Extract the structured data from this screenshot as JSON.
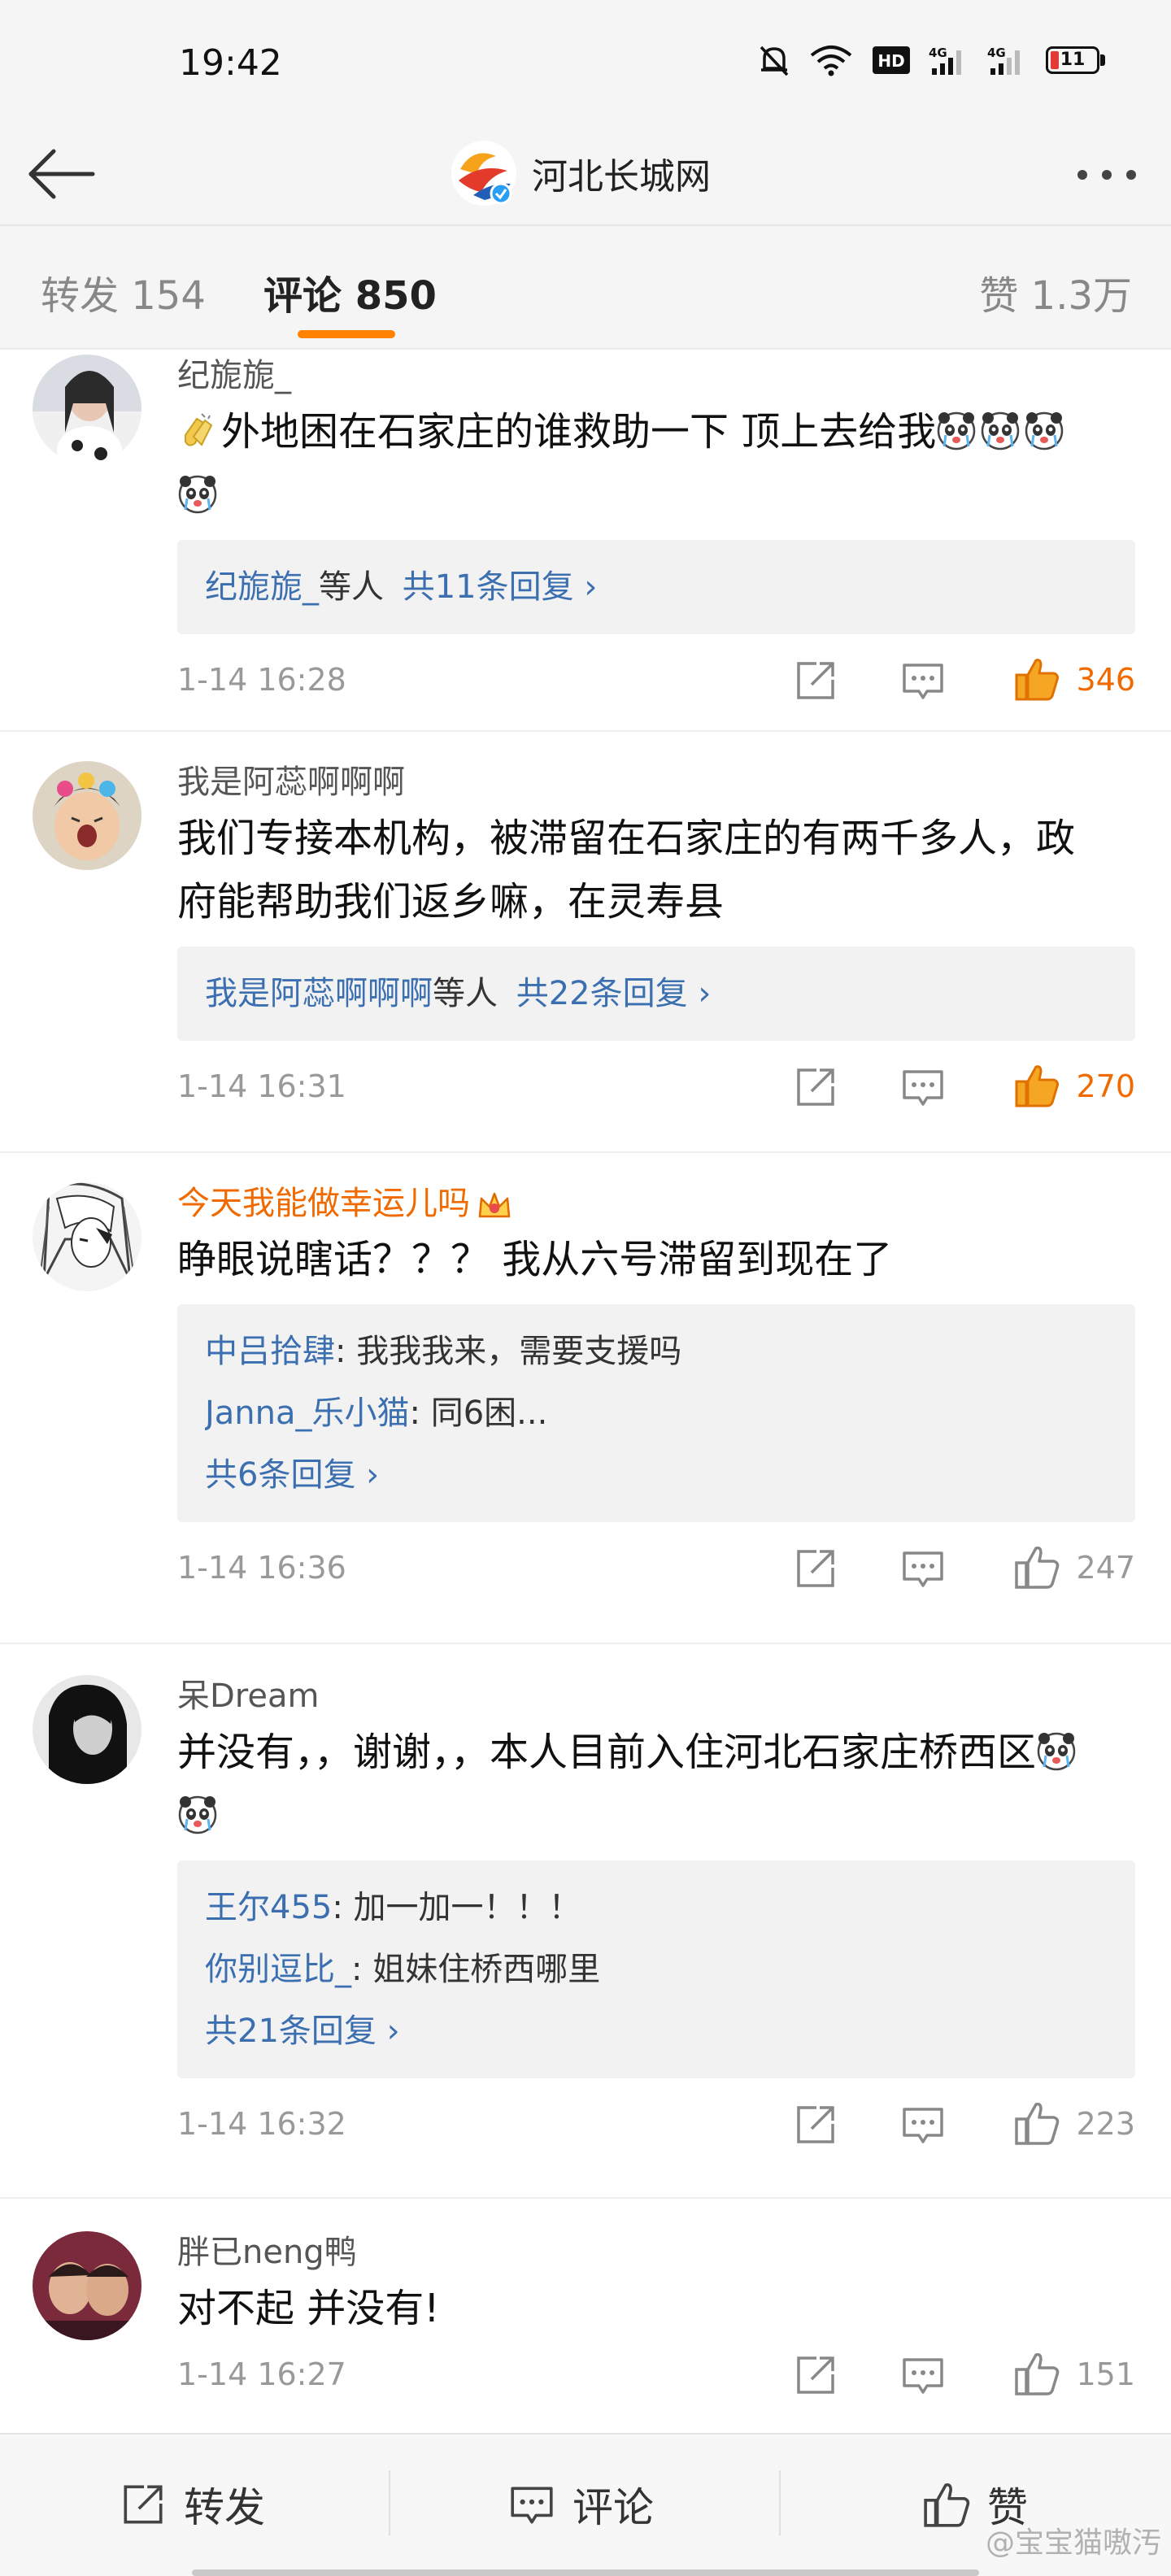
{
  "status_bar": {
    "time": "19:42",
    "battery": "11"
  },
  "header": {
    "title": "河北长城网"
  },
  "tabs": {
    "repost": "转发 154",
    "comments": "评论 850",
    "likes": "赞 1.3万"
  },
  "comments": [
    {
      "name": "纪旎旎_",
      "text_before": "外地困在石家庄的谁救助一下 顶上去给我",
      "reply_summary_name": "纪旎旎_",
      "reply_summary_suffix": "等人",
      "reply_summary_count": "共11条回复 ›",
      "time": "1-14 16:28",
      "likes": "346"
    },
    {
      "name": "我是阿蕊啊啊啊",
      "text": "我们专接本机构，被滞留在石家庄的有两千多人，政府能帮助我们返乡嘛，在灵寿县",
      "reply_summary_name": "我是阿蕊啊啊啊",
      "reply_summary_suffix": "等人",
      "reply_summary_count": "共22条回复 ›",
      "time": "1-14 16:31",
      "likes": "270"
    },
    {
      "name": "今天我能做幸运儿吗",
      "text": "睁眼说瞎话？？？ 我从六号滞留到现在了",
      "replies": [
        {
          "name": "中吕拾肆",
          "text": ": 我我我来，需要支援吗"
        },
        {
          "name": "Janna_乐小猫",
          "text": ": 同6困..."
        }
      ],
      "reply_count": "共6条回复 ›",
      "time": "1-14 16:36",
      "likes": "247"
    },
    {
      "name": "呆Dream",
      "text": "并没有，，谢谢，，本人目前入住河北石家庄桥西区",
      "replies": [
        {
          "name": "王尔455",
          "text": ": 加一加一！！！"
        },
        {
          "name": "你别逗比_",
          "text": ": 姐妹住桥西哪里"
        }
      ],
      "reply_count": "共21条回复 ›",
      "time": "1-14 16:32",
      "likes": "223"
    },
    {
      "name": "胖已neng鸭",
      "text": "对不起 并没有!",
      "time": "1-14 16:27",
      "likes": "151"
    }
  ],
  "bottom_bar": {
    "repost": "转发",
    "comment": "评论",
    "like": "赞"
  },
  "watermark": "@宝宝猫嗷汚",
  "colors": {
    "accent": "#ff8200",
    "link_blue": "#3b6fb0",
    "vip_orange": "#f06a00"
  }
}
